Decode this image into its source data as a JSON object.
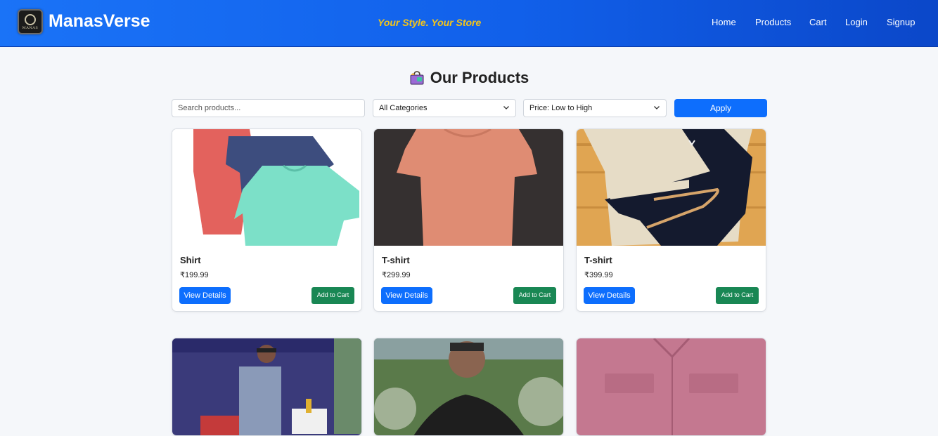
{
  "header": {
    "brand": "ManasVerse",
    "logo_text": "MANAS",
    "tagline": "Your Style. Your Store",
    "nav": [
      "Home",
      "Products",
      "Cart",
      "Login",
      "Signup"
    ]
  },
  "main": {
    "heading": "Our Products",
    "heading_icon": "shopping-bag-icon"
  },
  "filters": {
    "search_placeholder": "Search products...",
    "category": "All Categories",
    "sort": "Price: Low to High",
    "apply_label": "Apply"
  },
  "products": [
    {
      "name": "Shirt",
      "price": "₹199.99",
      "view_label": "View Details",
      "cart_label": "Add to Cart"
    },
    {
      "name": "T-shirt",
      "price": "₹299.99",
      "view_label": "View Details",
      "cart_label": "Add to Cart"
    },
    {
      "name": "T-shirt",
      "price": "₹399.99",
      "view_label": "View Details",
      "cart_label": "Add to Cart"
    }
  ],
  "colors": {
    "header_blue": "#1160ea",
    "tagline_yellow": "#f5c518",
    "primary_button": "#0d6efd",
    "cart_button": "#198754",
    "page_bg": "#f5f7fa"
  }
}
